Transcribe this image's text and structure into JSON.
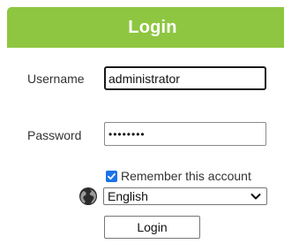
{
  "header": {
    "title": "Login",
    "background_color": "#8ec641"
  },
  "form": {
    "username_label": "Username",
    "username_value": "administrator",
    "password_label": "Password",
    "password_value": "••••••••",
    "remember_label": "Remember this account",
    "remember_checked": true,
    "language_icon": "globe-icon",
    "language_selected": "English",
    "login_button_label": "Login"
  },
  "colors": {
    "accent": "#8ec641",
    "checkbox": "#1a73e8"
  }
}
